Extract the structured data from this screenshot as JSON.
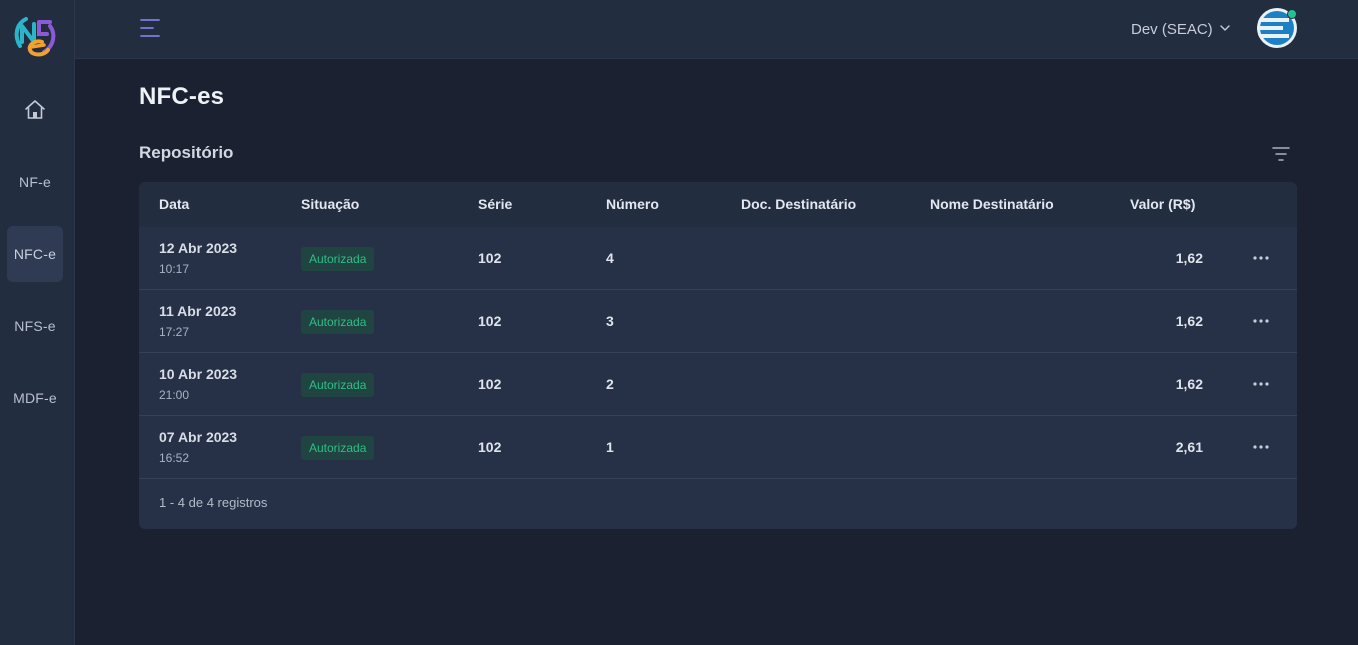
{
  "sidebar": {
    "logo_icon": "nfe-logo-icon",
    "home_icon": "home-icon",
    "items": [
      {
        "label": "NF-e",
        "active": false
      },
      {
        "label": "NFC-e",
        "active": true
      },
      {
        "label": "NFS-e",
        "active": false
      },
      {
        "label": "MDF-e",
        "active": false
      }
    ]
  },
  "header": {
    "menu_icon": "hamburger-menu-icon",
    "org_label": "Dev (SEAC)",
    "org_icon": "chevron-down-icon",
    "avatar_status_color": "#22c38e"
  },
  "main": {
    "title": "NFC-es",
    "section_title": "Repositório",
    "filter_icon": "filter-icon"
  },
  "table": {
    "columns": [
      "Data",
      "Situação",
      "Série",
      "Número",
      "Doc. Destinatário",
      "Nome Destinatário",
      "Valor (R$)"
    ],
    "rows": [
      {
        "date": "12 Abr 2023",
        "time": "10:17",
        "status": "Autorizada",
        "serie": "102",
        "numero": "4",
        "doc": "",
        "nome": "",
        "valor": "1,62"
      },
      {
        "date": "11 Abr 2023",
        "time": "17:27",
        "status": "Autorizada",
        "serie": "102",
        "numero": "3",
        "doc": "",
        "nome": "",
        "valor": "1,62"
      },
      {
        "date": "10 Abr 2023",
        "time": "21:00",
        "status": "Autorizada",
        "serie": "102",
        "numero": "2",
        "doc": "",
        "nome": "",
        "valor": "1,62"
      },
      {
        "date": "07 Abr 2023",
        "time": "16:52",
        "status": "Autorizada",
        "serie": "102",
        "numero": "1",
        "doc": "",
        "nome": "",
        "valor": "2,61"
      }
    ],
    "row_action_icon": "more-horizontal-icon",
    "footer": "1 - 4 de 4 registros"
  },
  "colors": {
    "background": "#1b2131",
    "panel": "#232d40",
    "card": "#263147",
    "status_badge_bg": "#1f4442",
    "status_badge_text": "#2fbf86"
  }
}
